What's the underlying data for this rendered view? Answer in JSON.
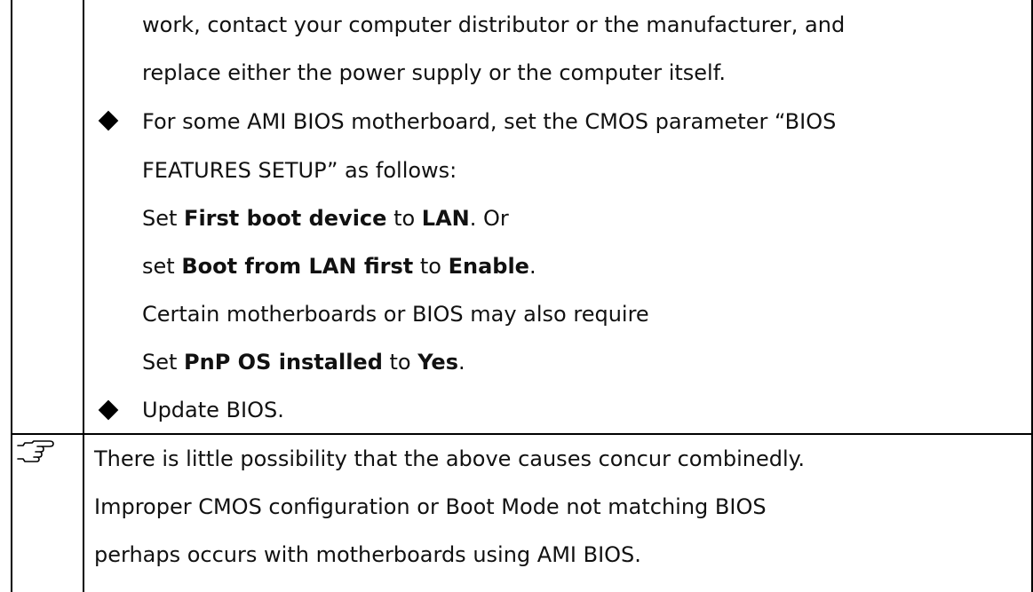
{
  "row1": {
    "continuation_lines": [
      "work, contact your computer distributor or the manufacturer, and",
      "replace either the power supply or the computer itself."
    ],
    "bullet_ami": {
      "line1": "For some AMI BIOS motherboard, set the CMOS parameter “BIOS",
      "line2": "FEATURES SETUP” as follows:"
    },
    "set_first_boot": {
      "pre": "Set ",
      "bold1": "First boot device",
      "mid": " to ",
      "bold2": "LAN",
      "post": ". Or"
    },
    "set_boot_lan": {
      "pre": "set ",
      "bold1": "Boot from LAN first",
      "mid": " to ",
      "bold2": "Enable",
      "post": "."
    },
    "certain_line": "Certain motherboards or BIOS may also require",
    "set_pnp": {
      "pre": "Set ",
      "bold1": "PnP OS installed",
      "mid": " to ",
      "bold2": "Yes",
      "post": "."
    },
    "bullet_update": "Update BIOS."
  },
  "row2": {
    "icon": "pointing-hand-icon",
    "lines": [
      "There is little possibility that the above causes concur combinedly.",
      "Improper CMOS configuration or Boot Mode not matching BIOS",
      "perhaps occurs with motherboards using AMI BIOS."
    ]
  }
}
